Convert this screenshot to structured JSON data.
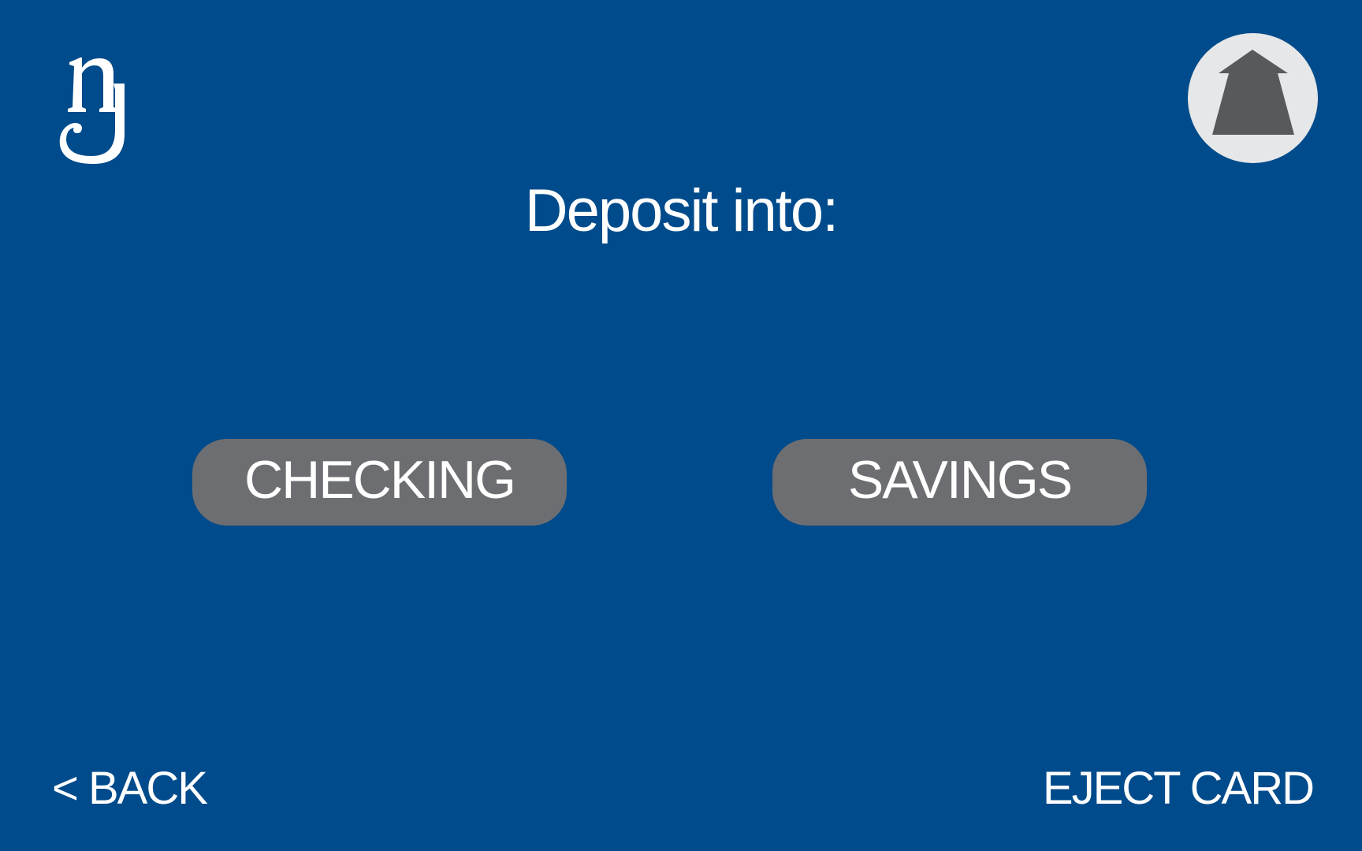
{
  "screen": {
    "background_color": "#004B8B",
    "title": "Deposit into:"
  },
  "logo": {
    "icon": "bank-monogram-logo",
    "color": "#FFFFFF"
  },
  "top_right_button": {
    "icon": "up-arrow-icon",
    "background_color": "#E6E7E8",
    "icon_color": "#58595B"
  },
  "options": {
    "checking_label": "CHECKING",
    "savings_label": "SAVINGS",
    "button_color": "#6D6E71"
  },
  "footer": {
    "back_label": "< BACK",
    "eject_label": "EJECT CARD"
  }
}
